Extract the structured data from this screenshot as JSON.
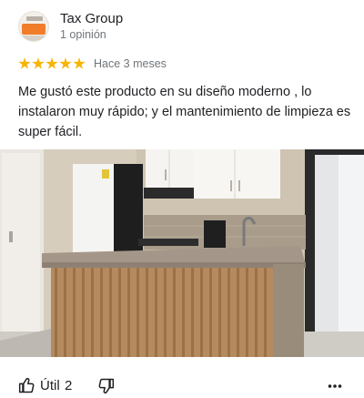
{
  "reviewer": {
    "name": "Tax Group",
    "review_count": "1 opinión",
    "avatar_icon": "business-logo"
  },
  "review": {
    "rating": 5,
    "max_rating": 5,
    "time": "Hace 3 meses",
    "text": "Me gustó este producto en su diseño moderno , lo instalaron muy rápido; y el mantenimiento de limpieza es super fácil.",
    "photo_subject": "kitchen"
  },
  "actions": {
    "like_label": "Útil",
    "like_count": "2",
    "like_icon": "thumbs-up-icon",
    "dislike_icon": "thumbs-down-icon",
    "more_icon": "more-horizontal-icon"
  },
  "colors": {
    "star": "#f7b400",
    "text": "#202124",
    "secondary_text": "#70757a"
  }
}
